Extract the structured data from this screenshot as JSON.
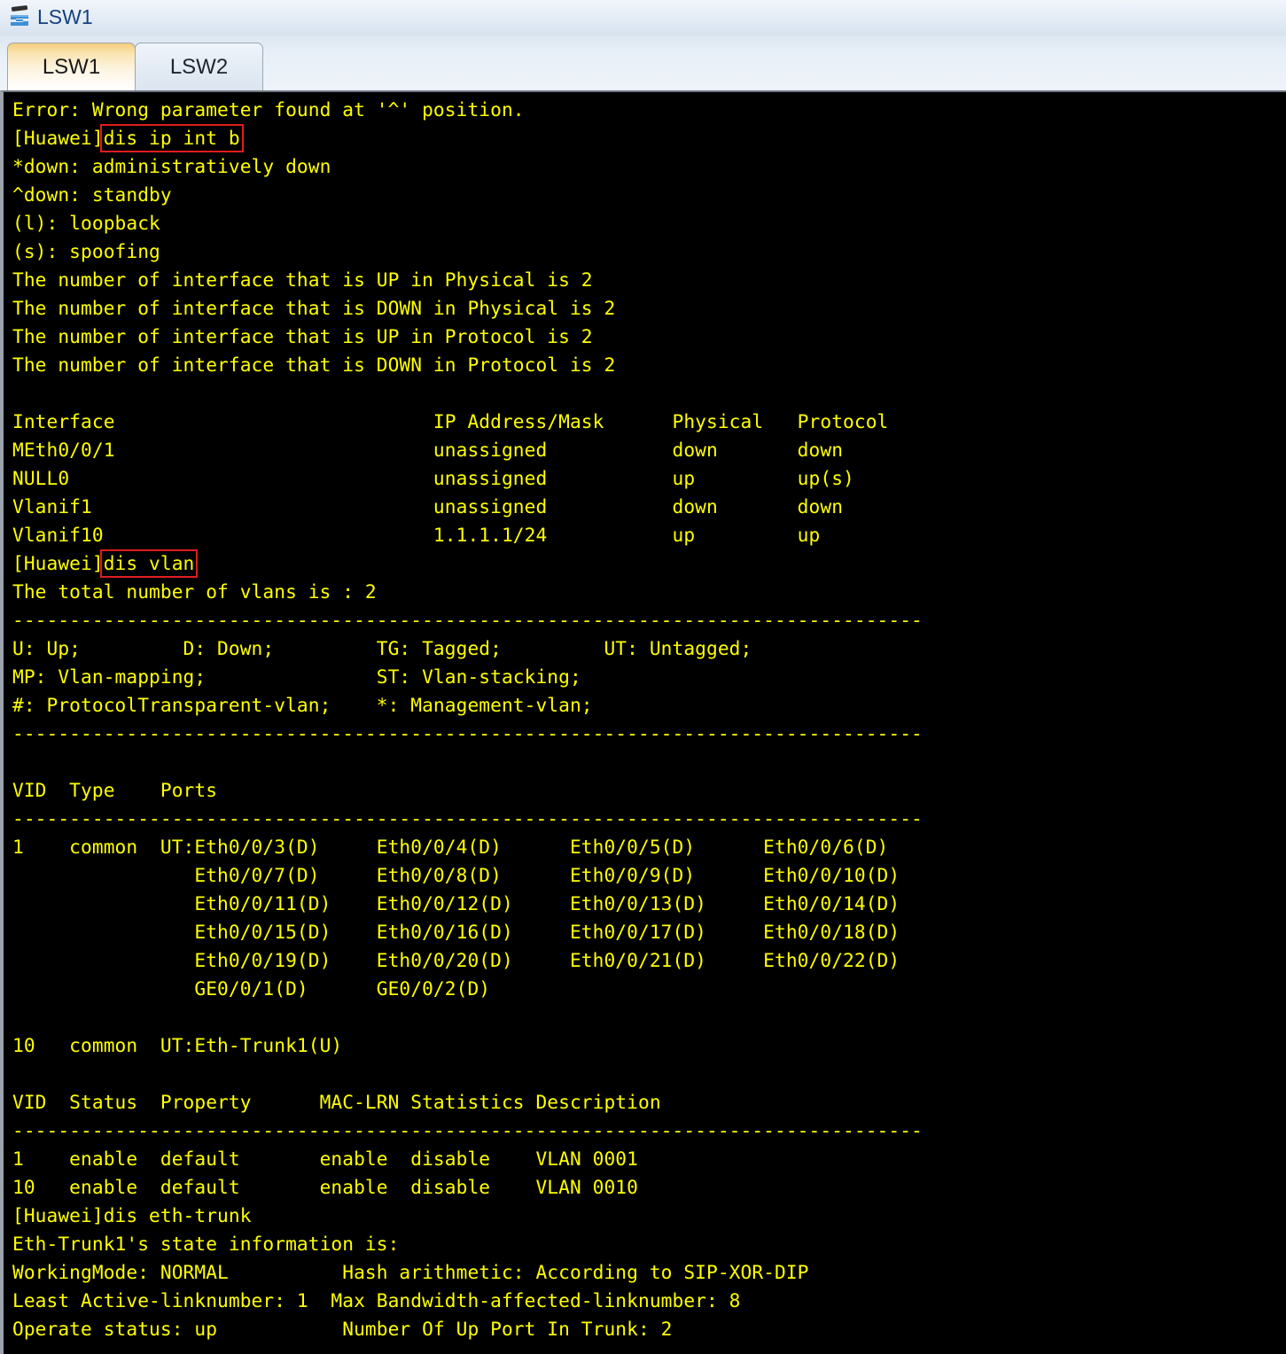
{
  "window": {
    "title": "LSW1",
    "icon": "switch-icon"
  },
  "tabs": [
    {
      "label": "LSW1",
      "active": true
    },
    {
      "label": "LSW2",
      "active": false
    }
  ],
  "colors": {
    "terminal_bg": "#000000",
    "terminal_fg": "#ffff00",
    "highlight_box": "#e01d1d",
    "title_text": "#15427e",
    "active_tab": "#f6cd7a"
  },
  "terminal": {
    "lines": [
      {
        "text": "Error: Wrong parameter found at '^' position."
      },
      {
        "prefix": "[Huawei]",
        "command": "dis ip int b",
        "boxed": true
      },
      {
        "text": "*down: administratively down"
      },
      {
        "text": "^down: standby"
      },
      {
        "text": "(l): loopback"
      },
      {
        "text": "(s): spoofing"
      },
      {
        "text": "The number of interface that is UP in Physical is 2"
      },
      {
        "text": "The number of interface that is DOWN in Physical is 2"
      },
      {
        "text": "The number of interface that is UP in Protocol is 2"
      },
      {
        "text": "The number of interface that is DOWN in Protocol is 2"
      },
      {
        "text": ""
      },
      {
        "text": "Interface                            IP Address/Mask      Physical   Protocol"
      },
      {
        "text": "MEth0/0/1                            unassigned           down       down"
      },
      {
        "text": "NULL0                                unassigned           up         up(s)"
      },
      {
        "text": "Vlanif1                              unassigned           down       down"
      },
      {
        "text": "Vlanif10                             1.1.1.1/24           up         up"
      },
      {
        "prefix": "[Huawei]",
        "command": "dis vlan",
        "boxed": true
      },
      {
        "text": "The total number of vlans is : 2"
      },
      {
        "text": "--------------------------------------------------------------------------------"
      },
      {
        "text": "U: Up;         D: Down;         TG: Tagged;         UT: Untagged;"
      },
      {
        "text": "MP: Vlan-mapping;               ST: Vlan-stacking;"
      },
      {
        "text": "#: ProtocolTransparent-vlan;    *: Management-vlan;"
      },
      {
        "text": "--------------------------------------------------------------------------------"
      },
      {
        "text": ""
      },
      {
        "text": "VID  Type    Ports"
      },
      {
        "text": "--------------------------------------------------------------------------------"
      },
      {
        "text": "1    common  UT:Eth0/0/3(D)     Eth0/0/4(D)      Eth0/0/5(D)      Eth0/0/6(D)"
      },
      {
        "text": "                Eth0/0/7(D)     Eth0/0/8(D)      Eth0/0/9(D)      Eth0/0/10(D)"
      },
      {
        "text": "                Eth0/0/11(D)    Eth0/0/12(D)     Eth0/0/13(D)     Eth0/0/14(D)"
      },
      {
        "text": "                Eth0/0/15(D)    Eth0/0/16(D)     Eth0/0/17(D)     Eth0/0/18(D)"
      },
      {
        "text": "                Eth0/0/19(D)    Eth0/0/20(D)     Eth0/0/21(D)     Eth0/0/22(D)"
      },
      {
        "text": "                GE0/0/1(D)      GE0/0/2(D)"
      },
      {
        "text": ""
      },
      {
        "text": "10   common  UT:Eth-Trunk1(U)"
      },
      {
        "text": ""
      },
      {
        "text": "VID  Status  Property      MAC-LRN Statistics Description"
      },
      {
        "text": "--------------------------------------------------------------------------------"
      },
      {
        "text": "1    enable  default       enable  disable    VLAN 0001"
      },
      {
        "text": "10   enable  default       enable  disable    VLAN 0010"
      },
      {
        "text": "[Huawei]dis eth-trunk"
      },
      {
        "text": "Eth-Trunk1's state information is:"
      },
      {
        "text": "WorkingMode: NORMAL          Hash arithmetic: According to SIP-XOR-DIP"
      },
      {
        "text": "Least Active-linknumber: 1  Max Bandwidth-affected-linknumber: 8"
      },
      {
        "text": "Operate status: up           Number Of Up Port In Trunk: 2"
      }
    ]
  }
}
